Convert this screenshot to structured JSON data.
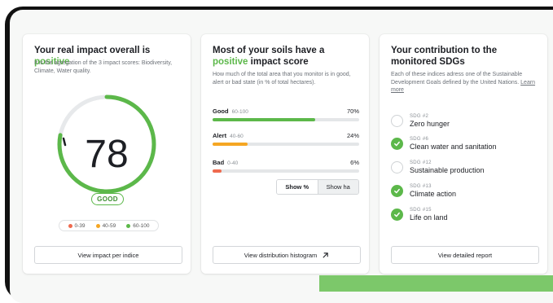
{
  "colors": {
    "accent": "#5cb84a",
    "red": "#ef6a4e",
    "orange": "#f5a623",
    "green": "#5cb84a"
  },
  "impact": {
    "title_pre": "Your real impact overall is ",
    "title_hl": "positive",
    "subtitle": "It is the agregation of the 3 impact scores: Biodiversity, Climate, Water quality.",
    "score": "78",
    "score_value": 78,
    "badge": "GOOD",
    "legend": [
      {
        "label": "0-39",
        "color": "#ef6a4e"
      },
      {
        "label": "40-59",
        "color": "#f5a623"
      },
      {
        "label": "60-100",
        "color": "#5cb84a"
      }
    ],
    "button": "View impact per indice"
  },
  "soils": {
    "title_pre": "Most of your soils have a ",
    "title_hl": "positive",
    "title_post": " impact score",
    "subtitle": "How much of the total area that you monitor is in good, alert or bad state (in % of total hectares).",
    "rows": [
      {
        "label": "Good",
        "range": "60-100",
        "pct": "70%",
        "value": 0.7,
        "color": "#5cb84a"
      },
      {
        "label": "Alert",
        "range": "40-60",
        "pct": "24%",
        "value": 0.24,
        "color": "#f5a623"
      },
      {
        "label": "Bad",
        "range": "0-40",
        "pct": "6%",
        "value": 0.06,
        "color": "#ef6a4e"
      }
    ],
    "toggle": [
      "Show %",
      "Show ha"
    ],
    "button": "View distribution histogram",
    "button_icon": "arrow-up-right-icon"
  },
  "sdgs": {
    "title": "Your contribution to the monitored SDGs",
    "subtitle": "Each of these indices adress one of the Sustainable Development Goals defined by the United Nations.",
    "link": "Learn more",
    "items": [
      {
        "code": "SDG #2",
        "name": "Zero hunger",
        "checked": false
      },
      {
        "code": "SDG #6",
        "name": "Clean water and sanitation",
        "checked": true
      },
      {
        "code": "SDG #12",
        "name": "Sustainable production",
        "checked": false
      },
      {
        "code": "SDG #13",
        "name": "Climate action",
        "checked": true
      },
      {
        "code": "SDG #15",
        "name": "Life on land",
        "checked": true
      }
    ],
    "button": "View detailed report"
  }
}
